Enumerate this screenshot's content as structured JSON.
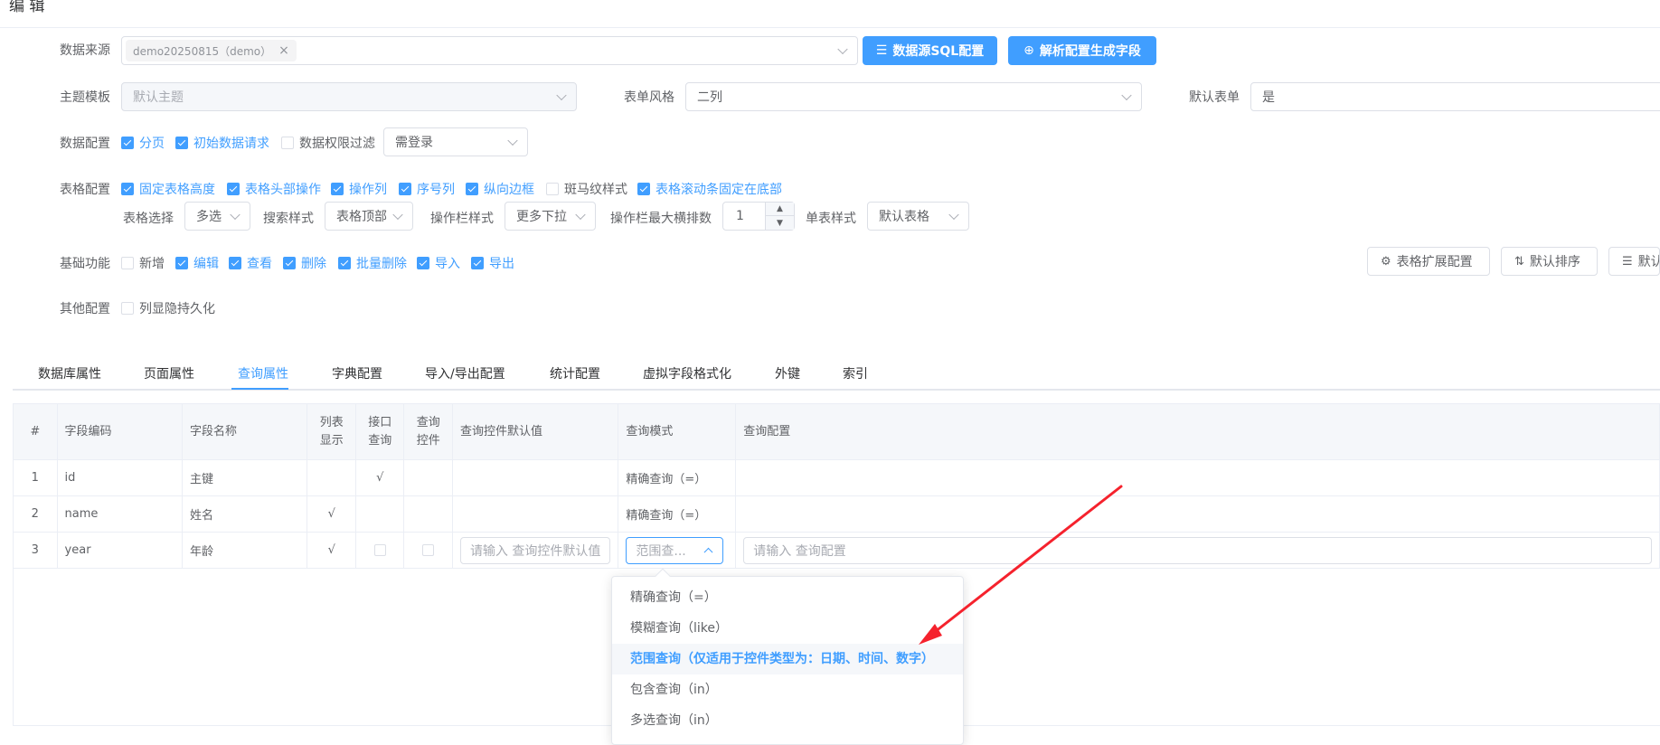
{
  "header": {
    "title": "编 辑"
  },
  "form": {
    "data_source": {
      "label": "数据来源",
      "tag": "demo20250815（demo）",
      "tag_close": "×",
      "sql_button": "数据源SQL配置",
      "parse_button": "解析配置生成字段"
    },
    "theme": {
      "label": "主题模板",
      "value": "默认主题"
    },
    "form_style": {
      "label": "表单风格",
      "value": "二列"
    },
    "default_form": {
      "label": "默认表单",
      "value": "是"
    },
    "data_config": {
      "label": "数据配置",
      "checks": [
        {
          "text": "分页",
          "checked": true
        },
        {
          "text": "初始数据请求",
          "checked": true
        },
        {
          "text": "数据权限过滤",
          "checked": false
        }
      ],
      "login_select": "需登录"
    },
    "table_config": {
      "label": "表格配置",
      "checks": [
        {
          "text": "固定表格高度",
          "checked": true
        },
        {
          "text": "表格头部操作",
          "checked": true
        },
        {
          "text": "操作列",
          "checked": true
        },
        {
          "text": "序号列",
          "checked": true
        },
        {
          "text": "纵向边框",
          "checked": true
        },
        {
          "text": "斑马纹样式",
          "checked": false
        },
        {
          "text": "表格滚动条固定在底部",
          "checked": true
        }
      ],
      "table_select_label": "表格选择",
      "table_select_value": "多选",
      "search_style_label": "搜索样式",
      "search_style_value": "表格顶部",
      "op_style_label": "操作栏样式",
      "op_style_value": "更多下拉",
      "op_max_label": "操作栏最大横排数",
      "op_max_value": "1",
      "single_style_label": "单表样式",
      "single_style_value": "默认表格"
    },
    "basic": {
      "label": "基础功能",
      "checks": [
        {
          "text": "新增",
          "checked": false
        },
        {
          "text": "编辑",
          "checked": true
        },
        {
          "text": "查看",
          "checked": true
        },
        {
          "text": "删除",
          "checked": true
        },
        {
          "text": "批量删除",
          "checked": true
        },
        {
          "text": "导入",
          "checked": true
        },
        {
          "text": "导出",
          "checked": true
        }
      ],
      "ext_button": "表格扩展配置",
      "sort_button": "默认排序",
      "cut_button": "默认"
    },
    "other": {
      "label": "其他配置",
      "checks": [
        {
          "text": "列显隐持久化",
          "checked": false
        }
      ]
    }
  },
  "tabs": [
    "数据库属性",
    "页面属性",
    "查询属性",
    "字典配置",
    "导入/导出配置",
    "统计配置",
    "虚拟字段格式化",
    "外键",
    "索引"
  ],
  "active_tab": "查询属性",
  "table": {
    "headers": [
      "#",
      "字段编码",
      "字段名称",
      "列表显示",
      "接口查询",
      "查询控件",
      "查询控件默认值",
      "查询模式",
      "查询配置"
    ],
    "rows": [
      {
        "no": "1",
        "code": "id",
        "name": "主键",
        "list": "",
        "api": "√",
        "ctrl": "",
        "default": "",
        "mode": "精确查询（=）",
        "config": ""
      },
      {
        "no": "2",
        "code": "name",
        "name": "姓名",
        "list": "√",
        "api": "",
        "ctrl": "",
        "default": "",
        "mode": "精确查询（=）",
        "config": ""
      },
      {
        "no": "3",
        "code": "year",
        "name": "年龄",
        "list": "√",
        "api": "",
        "ctrl": "",
        "default_placeholder": "请输入 查询控件默认值",
        "mode_value": "范围查...",
        "config_placeholder": "请输入 查询配置"
      }
    ]
  },
  "dropdown": {
    "options": [
      "精确查询（=）",
      "模糊查询（like）",
      "范围查询（仅适用于控件类型为：日期、时间、数字）",
      "包含查询（in）",
      "多选查询（in）"
    ],
    "selected_index": 2
  },
  "colors": {
    "primary": "#409eff",
    "border": "#dcdfe6",
    "arrow": "#f5222d"
  }
}
